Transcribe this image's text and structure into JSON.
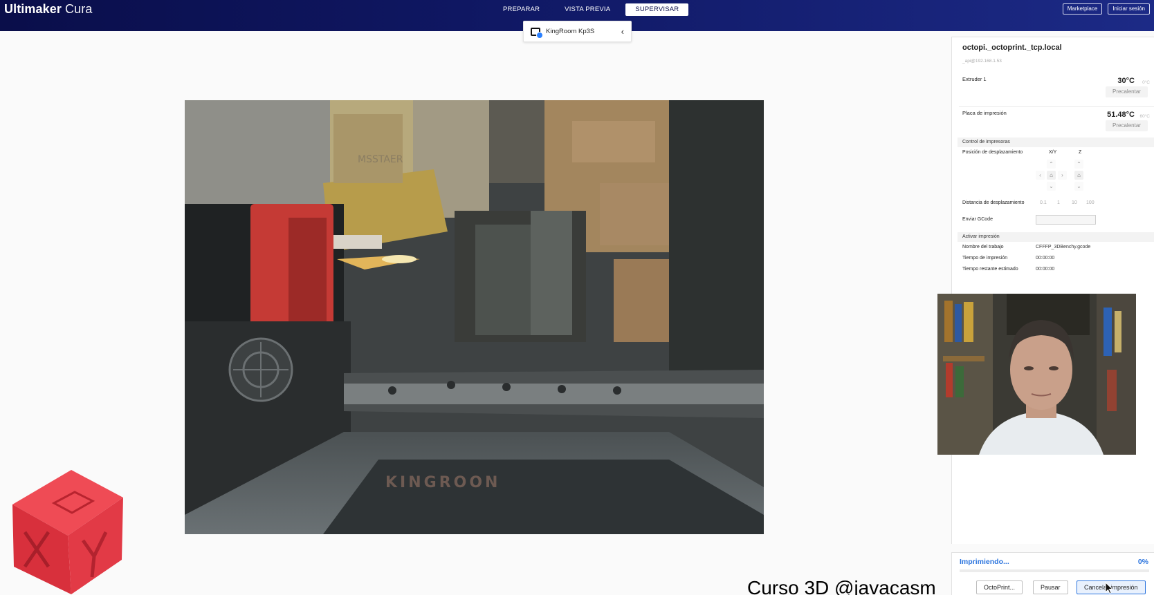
{
  "app": {
    "brand_bold": "Ultimaker",
    "brand_light": " Cura"
  },
  "stages": [
    {
      "label": "PREPARAR",
      "active": false
    },
    {
      "label": "VISTA PREVIA",
      "active": false
    },
    {
      "label": "SUPERVISAR",
      "active": true
    }
  ],
  "header_right": {
    "marketplace": "Marketplace",
    "login": "Iniciar sesión"
  },
  "printer_selector": {
    "name": "KingRoom Kp3S",
    "icon": "printer-network-icon"
  },
  "monitor": {
    "printer_host": "octopi._octoprint._tcp.local",
    "printer_address": "_api@192.168.1.53",
    "extruder": {
      "label": "Extruder 1",
      "temp": "30°C",
      "target": "0°C",
      "preheat": "Precalentar"
    },
    "bed": {
      "label": "Placa de impresión",
      "temp": "51.48°C",
      "target": "60°C",
      "preheat": "Precalentar"
    },
    "control": {
      "section": "Control de impresoras",
      "jog_label": "Posición de desplazamiento",
      "xy_label": "X/Y",
      "z_label": "Z",
      "distance_label": "Distancia de desplazamiento",
      "distances": [
        "0.1",
        "1",
        "10",
        "100"
      ],
      "gcode_label": "Enviar GCode",
      "gcode_value": ""
    },
    "job": {
      "section": "Activar impresión",
      "name_label": "Nombre del trabajo",
      "name_value": "CFFFP_3DBenchy.gcode",
      "time_label": "Tiempo de impresión",
      "time_value": "00:00:00",
      "remaining_label": "Tiempo restante estimado",
      "remaining_value": "00:00:00"
    }
  },
  "status": {
    "label": "Imprimiendo...",
    "percent_text": "0%",
    "progress": 0,
    "buttons": {
      "octoprint": "OctoPrint...",
      "pause": "Pausar",
      "cancel": "Cancelar impresión"
    }
  },
  "overlay": {
    "watermark": "Curso 3D @javacasm",
    "camera_box_label": "MSSTAER",
    "bed_brand": "KINGROON"
  },
  "colors": {
    "topbar": "#0f1762",
    "accent": "#2b74de",
    "cube": "#e8333f"
  }
}
